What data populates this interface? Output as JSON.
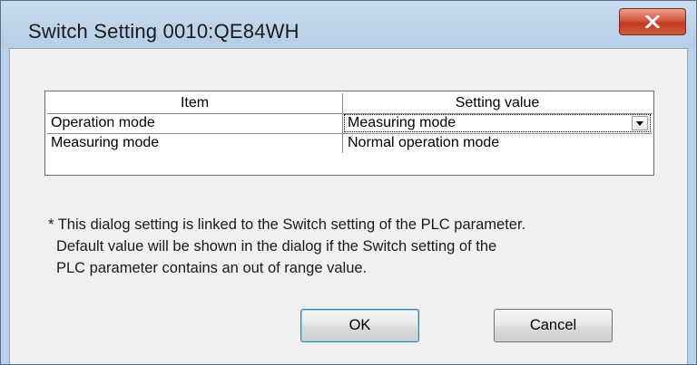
{
  "window": {
    "title": "Switch Setting 0010:QE84WH"
  },
  "colors": {
    "titlebar": "#b9d1ea",
    "close_button": "#c23a22",
    "client": "#f0f0f0"
  },
  "grid": {
    "headers": [
      "Item",
      "Setting value"
    ],
    "rows": [
      {
        "item": "Operation mode",
        "value": "Measuring mode",
        "control": "dropdown"
      },
      {
        "item": "Measuring mode",
        "value": "Normal operation mode",
        "control": "text"
      }
    ]
  },
  "note": {
    "line1": "* This dialog setting is linked to the Switch setting of the PLC parameter.",
    "line2": "Default value will be shown in the dialog if the Switch setting of the",
    "line3": "PLC parameter contains an out of range value."
  },
  "buttons": {
    "ok": "OK",
    "cancel": "Cancel"
  },
  "icons": {
    "close": "close-icon",
    "dropdown": "chevron-down-icon"
  }
}
